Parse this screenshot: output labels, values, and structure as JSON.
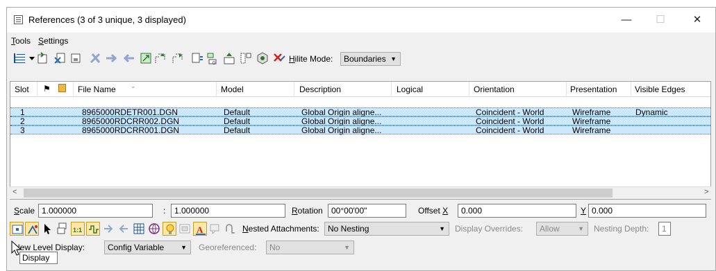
{
  "window": {
    "title": "References (3 of 3 unique, 3 displayed)",
    "minimize_glyph": "—",
    "maximize_glyph": "☐",
    "close_glyph": "✕"
  },
  "menu": {
    "tools": {
      "u": "T",
      "rest": "ools"
    },
    "settings": {
      "u": "S",
      "rest": "ettings"
    }
  },
  "toolbar": {
    "hilite_u": "H",
    "hilite_rest": "ilite Mode:",
    "hilite_value": "Boundaries",
    "icons": [
      "list-view-icon",
      "attach-reference-icon",
      "detach-reference-icon",
      "reload-reference-icon",
      "exchange-icon",
      "move-icon",
      "copy-icon",
      "scale-icon",
      "rotate-icon",
      "mirror-horizontal-icon",
      "mirror-vertical-icon",
      "clip-boundary-icon",
      "clip-mask-icon",
      "delete-clip-icon",
      "clip-front-icon",
      "clip-back-icon",
      "3d-view-icon",
      "delete-reference-icon"
    ]
  },
  "table": {
    "headers": [
      "Slot",
      "File Name",
      "Model",
      "Description",
      "Logical",
      "Orientation",
      "Presentation",
      "Visible Edges"
    ],
    "rows": [
      {
        "slot": "1",
        "file": "8965000RDETR001.DGN",
        "model": "Default",
        "desc": "Global Origin aligne...",
        "logical": "",
        "orientation": "Coincident - World",
        "presentation": "Wireframe",
        "edges": "Dynamic"
      },
      {
        "slot": "2",
        "file": "8965000RDCRR002.DGN",
        "model": "Default",
        "desc": "Global Origin aligne...",
        "logical": "",
        "orientation": "Coincident - World",
        "presentation": "Wireframe",
        "edges": ""
      },
      {
        "slot": "3",
        "file": "8965000RDCRR001.DGN",
        "model": "Default",
        "desc": "Global Origin aligne...",
        "logical": "",
        "orientation": "Coincident - World",
        "presentation": "Wireframe",
        "edges": ""
      }
    ]
  },
  "scroll": {
    "left_glyph": "<",
    "right_glyph": ">"
  },
  "fields": {
    "scale_u": "S",
    "scale_rest": "cale",
    "scale_a": "1.000000",
    "colon": ":",
    "scale_b": "1.000000",
    "rotation_u": "R",
    "rotation_rest": "otation",
    "rotation": "00°00'00\"",
    "offset_x_pre": "Offset ",
    "offset_x_u": "X",
    "offset_x": "0.000",
    "offset_y_u": "Y",
    "offset_y": "0.000"
  },
  "options": {
    "nested_u": "N",
    "nested_rest": "ested Attachments:",
    "nested_value": "No Nesting",
    "display_overrides_label": "Display Overrides:",
    "display_overrides_value": "Allow",
    "nesting_depth_label": "Nesting Depth:",
    "nesting_depth_value": "1",
    "new_level_label": "New Level Display:",
    "new_level_value": "Config Variable",
    "georef_label": "Georeferenced:",
    "georef_value": "No"
  },
  "tooltip": "Display",
  "colors": {
    "row_highlight": "#cce8ff",
    "active_icon": "#ffe8a6"
  }
}
